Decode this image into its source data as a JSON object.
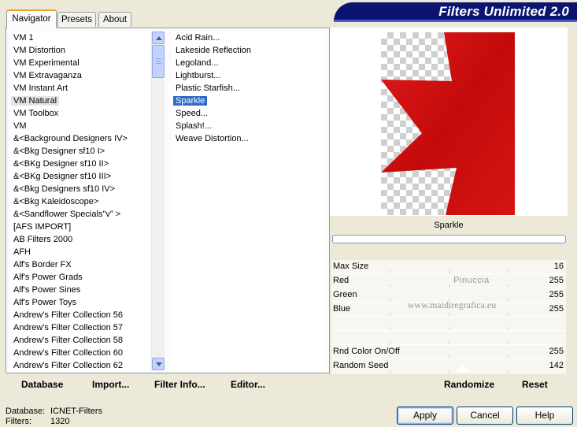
{
  "banner": {
    "title": "Filters Unlimited 2.0"
  },
  "tabs": [
    {
      "label": "Navigator",
      "active": true
    },
    {
      "label": "Presets",
      "active": false
    },
    {
      "label": "About",
      "active": false
    }
  ],
  "categories": {
    "items": [
      "VM 1",
      "VM Distortion",
      "VM Experimental",
      "VM Extravaganza",
      "VM Instant Art",
      "VM Natural",
      "VM Toolbox",
      "VM",
      "&<Background Designers IV>",
      "&<Bkg Designer sf10 I>",
      "&<BKg Designer sf10 II>",
      "&<BKg Designer sf10 III>",
      "&<Bkg Designers sf10 IV>",
      "&<Bkg Kaleidoscope>",
      "&<Sandflower Specials\"v\" >",
      "[AFS IMPORT]",
      "AB Filters 2000",
      "AFH",
      "Alf's Border FX",
      "Alf's Power Grads",
      "Alf's Power Sines",
      "Alf's Power Toys",
      "Andrew's Filter Collection 56",
      "Andrew's Filter Collection 57",
      "Andrew's Filter Collection 58",
      "Andrew's Filter Collection 60",
      "Andrew's Filter Collection 62"
    ],
    "selected": "VM Natural"
  },
  "filters": {
    "items": [
      "Acid Rain...",
      "Lakeside Reflection",
      "Legoland...",
      "Lightburst...",
      "Plastic Starfish...",
      "Sparkle",
      "Speed...",
      "Splash!...",
      "Weave Distortion..."
    ],
    "selected": "Sparkle"
  },
  "preview": {
    "filter_name": "Sparkle",
    "watermark": [
      "Pinuccia",
      "www.maidiregrafica.eu"
    ],
    "shape_color": "#d40f0f"
  },
  "params": [
    {
      "label": "Max Size",
      "value": "16"
    },
    {
      "label": "Red",
      "value": "255"
    },
    {
      "label": "Green",
      "value": "255"
    },
    {
      "label": "Blue",
      "value": "255"
    },
    {
      "label": "",
      "value": ""
    },
    {
      "label": "",
      "value": ""
    },
    {
      "label": "Rnd Color On/Off",
      "value": "255"
    },
    {
      "label": "Random Seed",
      "value": "142"
    }
  ],
  "bottom_buttons": {
    "database": "Database",
    "import": "Import...",
    "filter_info": "Filter Info...",
    "editor": "Editor..."
  },
  "right_buttons": {
    "randomize": "Randomize",
    "reset": "Reset"
  },
  "status": {
    "database_label": "Database:",
    "database_value": "ICNET-Filters",
    "filters_label": "Filters:",
    "filters_value": "1320"
  },
  "dialog_buttons": {
    "apply": "Apply",
    "cancel": "Cancel",
    "help": "Help"
  }
}
